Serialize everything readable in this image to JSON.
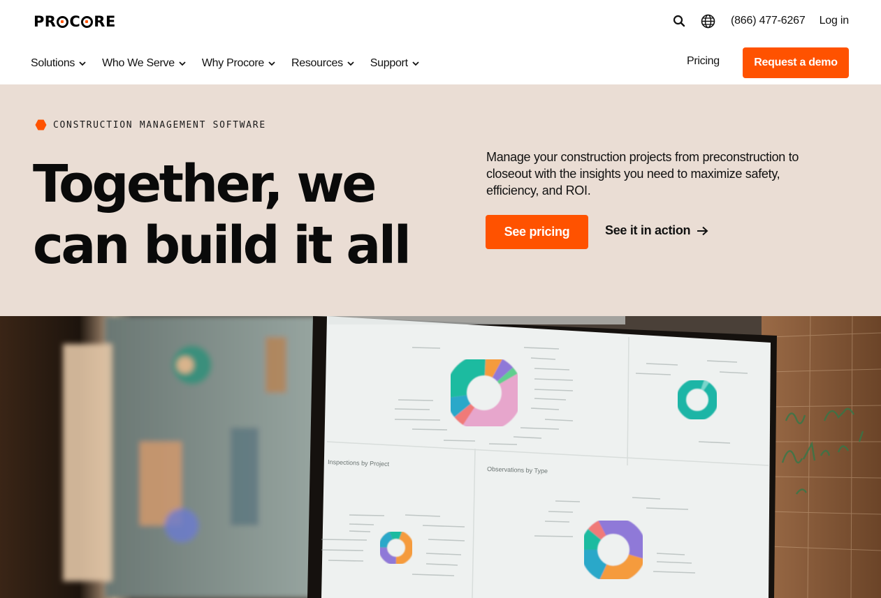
{
  "brand": {
    "logo_text": "PROCORE",
    "accent": "#ff5200",
    "hero_bg": "#eaddd4"
  },
  "utility": {
    "search_icon": "search-icon",
    "globe_icon": "globe-icon",
    "phone": "(866) 477-6267",
    "login": "Log in"
  },
  "nav": {
    "items": [
      {
        "label": "Solutions"
      },
      {
        "label": "Who We Serve"
      },
      {
        "label": "Why Procore"
      },
      {
        "label": "Resources"
      },
      {
        "label": "Support"
      }
    ],
    "pricing": "Pricing",
    "demo": "Request a demo"
  },
  "hero": {
    "eyebrow": "CONSTRUCTION MANAGEMENT SOFTWARE",
    "headline_line1": "Together, we",
    "headline_line2": "can build it all",
    "lede": "Manage your construction projects from preconstruction to closeout with the insights you need to maximize safety, efficiency, and ROI.",
    "cta_primary": "See pricing",
    "cta_secondary": "See it in action"
  },
  "media": {
    "panel_top_left": "",
    "panel_inspections": "Inspections by Project",
    "panel_observations": "Observations by Type"
  }
}
